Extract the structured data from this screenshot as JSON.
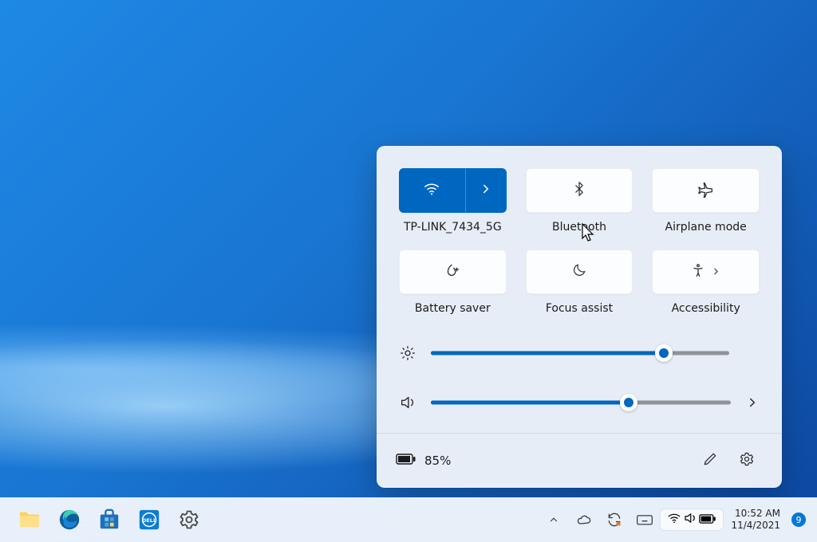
{
  "quick_settings": {
    "tiles": [
      {
        "label": "TP-LINK_7434_5G"
      },
      {
        "label": "Bluetooth"
      },
      {
        "label": "Airplane mode"
      },
      {
        "label": "Battery saver"
      },
      {
        "label": "Focus assist"
      },
      {
        "label": "Accessibility"
      }
    ],
    "brightness": {
      "percent": 78
    },
    "volume": {
      "percent": 66
    },
    "battery": {
      "percent_text": "85%"
    }
  },
  "taskbar": {
    "time": "10:52 AM",
    "date": "11/4/2021",
    "notifications": "9"
  }
}
